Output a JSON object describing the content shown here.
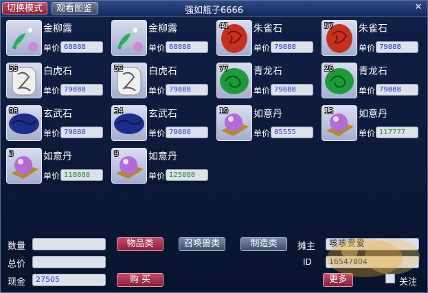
{
  "titlebar": {
    "mode_button": "切换模式",
    "view_button": "观看图鉴",
    "title": "强如瓶子6666",
    "close": "✕"
  },
  "price_label": "单价",
  "items": [
    {
      "name": "金柳露",
      "qty": "",
      "price": "68888",
      "price_color": "#1c2fd0",
      "icon": "leaf-potion-icon"
    },
    {
      "name": "金柳露",
      "qty": "",
      "price": "68888",
      "price_color": "#1c2fd0",
      "icon": "leaf-potion-icon"
    },
    {
      "name": "朱雀石",
      "qty": "41",
      "price": "79888",
      "price_color": "#1c2fd0",
      "icon": "red-stone-icon"
    },
    {
      "name": "朱雀石",
      "qty": "57",
      "price": "79888",
      "price_color": "#1c2fd0",
      "icon": "red-stone-icon"
    },
    {
      "name": "白虎石",
      "qty": "55",
      "price": "79888",
      "price_color": "#1c2fd0",
      "icon": "white-stone-icon"
    },
    {
      "name": "白虎石",
      "qty": "52",
      "price": "79888",
      "price_color": "#1c2fd0",
      "icon": "white-stone-icon"
    },
    {
      "name": "青龙石",
      "qty": "77",
      "price": "79888",
      "price_color": "#1c2fd0",
      "icon": "green-stone-icon"
    },
    {
      "name": "青龙石",
      "qty": "26",
      "price": "79888",
      "price_color": "#1c2fd0",
      "icon": "green-stone-icon"
    },
    {
      "name": "玄武石",
      "qty": "98",
      "price": "79888",
      "price_color": "#1c2fd0",
      "icon": "blue-stone-icon"
    },
    {
      "name": "玄武石",
      "qty": "34",
      "price": "79888",
      "price_color": "#1c2fd0",
      "icon": "blue-stone-icon"
    },
    {
      "name": "如意丹",
      "qty": "19",
      "price": "85555",
      "price_color": "#1c2fd0",
      "icon": "pearl-icon"
    },
    {
      "name": "如意丹",
      "qty": "13",
      "price": "117777",
      "price_color": "#1a8a1a",
      "icon": "pearl-icon"
    },
    {
      "name": "如意丹",
      "qty": "3",
      "price": "118888",
      "price_color": "#1a8a1a",
      "icon": "pearl-icon"
    },
    {
      "name": "如意丹",
      "qty": "9",
      "price": "125888",
      "price_color": "#1a8a1a",
      "icon": "pearl-icon"
    }
  ],
  "bottom": {
    "quantity_label": "数量",
    "quantity_value": "",
    "total_label": "总价",
    "total_value": "",
    "cash_label": "现金",
    "cash_value": "27505",
    "btn_items": "物品类",
    "btn_pets": "召唤兽类",
    "btn_craft": "制造类",
    "btn_buy": "购 买",
    "owner_label": "摊主",
    "owner_value": "咳咳爱爱",
    "id_label": "ID",
    "id_value": "16547804",
    "more_button": "更多",
    "follow_label": "关注"
  },
  "colors": {
    "accent_red": "#8a1f3a",
    "price_blue": "#1c2fd0",
    "price_green": "#1a8a1a"
  }
}
